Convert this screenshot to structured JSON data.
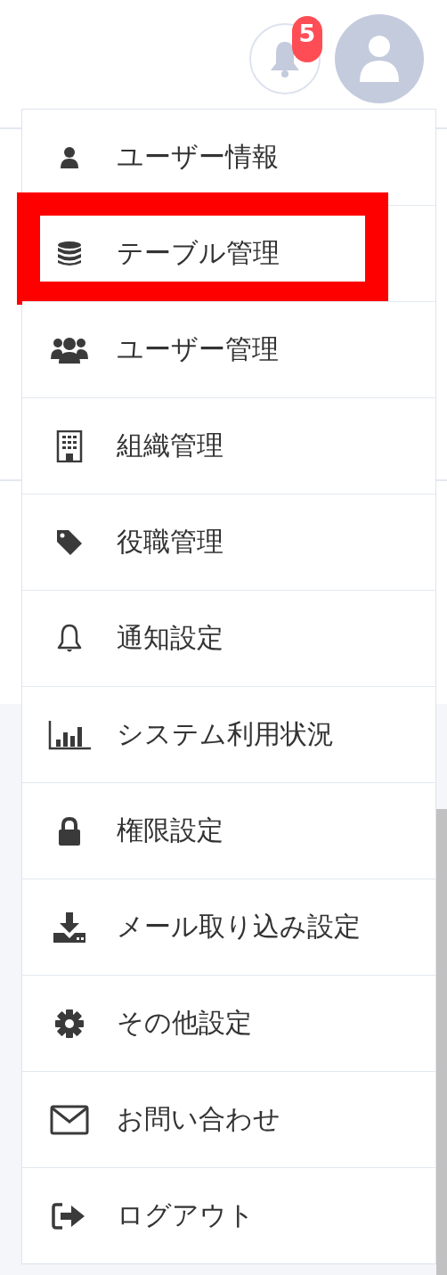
{
  "header": {
    "notification_badge": "5"
  },
  "menu": {
    "items": [
      {
        "label": "ユーザー情報",
        "highlighted": false
      },
      {
        "label": "テーブル管理",
        "highlighted": true
      },
      {
        "label": "ユーザー管理",
        "highlighted": false
      },
      {
        "label": "組織管理",
        "highlighted": false
      },
      {
        "label": "役職管理",
        "highlighted": false
      },
      {
        "label": "通知設定",
        "highlighted": false
      },
      {
        "label": "システム利用状況",
        "highlighted": false
      },
      {
        "label": "権限設定",
        "highlighted": false
      },
      {
        "label": "メール取り込み設定",
        "highlighted": false
      },
      {
        "label": "その他設定",
        "highlighted": false
      },
      {
        "label": "お問い合わせ",
        "highlighted": false
      },
      {
        "label": "ログアウト",
        "highlighted": false
      }
    ]
  }
}
